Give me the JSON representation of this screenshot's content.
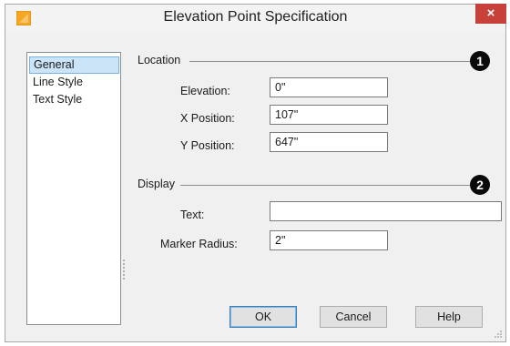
{
  "window": {
    "title": "Elevation Point Specification",
    "close_glyph": "×"
  },
  "sidebar": {
    "items": [
      {
        "label": "General",
        "selected": true
      },
      {
        "label": "Line Style",
        "selected": false
      },
      {
        "label": "Text Style",
        "selected": false
      }
    ]
  },
  "location": {
    "heading": "Location",
    "badge": "1",
    "elevation_label": "Elevation:",
    "elevation_value": "0\"",
    "x_label": "X Position:",
    "x_value": "107\"",
    "y_label": "Y Position:",
    "y_value": "647\""
  },
  "display": {
    "heading": "Display",
    "badge": "2",
    "text_label": "Text:",
    "text_value": "",
    "radius_label": "Marker Radius:",
    "radius_value": "2\""
  },
  "buttons": {
    "ok": "OK",
    "cancel": "Cancel",
    "help": "Help"
  },
  "colors": {
    "accent": "#c7403a",
    "selection": "#cce4f7",
    "app_icon": "#f5a623"
  }
}
